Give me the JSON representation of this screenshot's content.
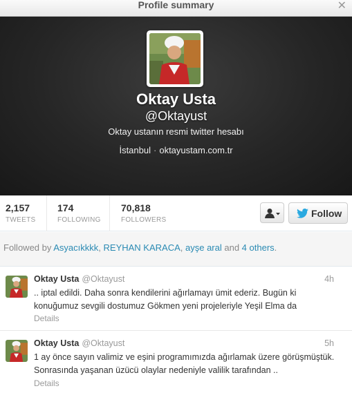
{
  "window": {
    "title": "Profile summary",
    "close_glyph": "✕"
  },
  "profile": {
    "fullname": "Oktay Usta",
    "screen_name": "@Oktayust",
    "bio": "Oktay ustanın resmi twitter hesabı",
    "location": "İstanbul",
    "separator": "·",
    "url": "oktayustam.com.tr",
    "avatar_icon": "chef-avatar"
  },
  "stats": [
    {
      "value": "2,157",
      "label": "TWEETS"
    },
    {
      "value": "174",
      "label": "FOLLOWING"
    },
    {
      "value": "70,818",
      "label": "FOLLOWERS"
    }
  ],
  "actions": {
    "user_menu_icon": "user-dropdown-icon",
    "follow_label": "Follow"
  },
  "followed_by": {
    "prefix": "Followed by ",
    "names": [
      "Asyacıkkkk",
      "REYHAN KARACA",
      "ayşe aral"
    ],
    "sep1": ", ",
    "sep2": ", ",
    "and": " and ",
    "others": "4 others",
    "suffix": "."
  },
  "tweets": [
    {
      "name": "Oktay Usta",
      "handle": "@Oktayust",
      "time": "4h",
      "text": ".. iptal edildi. Daha sonra kendilerini ağırlamayı ümit ederiz. Bugün ki konuğumuz sevgili dostumuz Gökmen yeni projeleriyle Yeşil Elma da",
      "details": "Details"
    },
    {
      "name": "Oktay Usta",
      "handle": "@Oktayust",
      "time": "5h",
      "text": "1 ay önce sayın valimiz ve eşini programımızda ağırlamak üzere görüşmüştük. Sonrasında yaşanan üzücü olaylar nedeniyle valilik tarafından ..",
      "details": "Details"
    }
  ],
  "colors": {
    "link": "#2a8ab3",
    "header_bg": "#262626",
    "twitter_blue": "#2aa9e0"
  }
}
